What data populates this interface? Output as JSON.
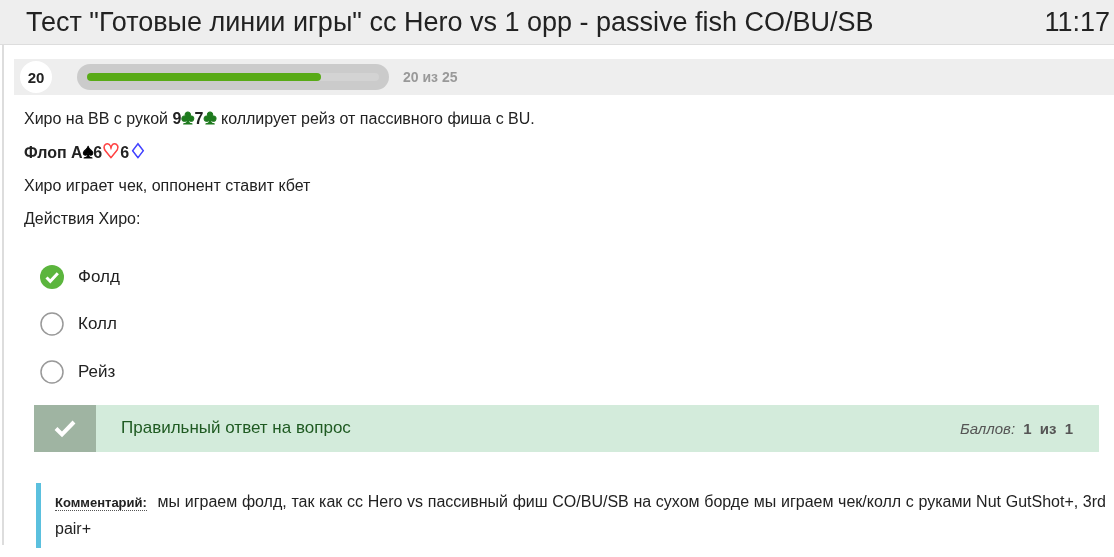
{
  "header": {
    "title": "Тест \"Готовые линии игры\" cc Hero vs 1 opp - passive fish CO/BU/SB",
    "time": "11:17"
  },
  "progress": {
    "number": "20",
    "level": 0.8,
    "label": "20 из 25"
  },
  "question": [
    {
      "segments": [
        {
          "kind": "text",
          "text": "Хиро на BB с рукой "
        },
        {
          "kind": "bold",
          "text": "9"
        },
        {
          "kind": "suit",
          "text": "♣",
          "color": "#1e7a1e"
        },
        {
          "kind": "bold",
          "text": "7"
        },
        {
          "kind": "suit",
          "text": "♣",
          "color": "#1e7a1e"
        },
        {
          "kind": "text",
          "text": " коллирует рейз от пассивного фиша с BU."
        }
      ]
    },
    {
      "segments": [
        {
          "kind": "bold",
          "text": "Флоп А"
        },
        {
          "kind": "suit",
          "text": "♠",
          "color": "#000000"
        },
        {
          "kind": "bold",
          "text": "6"
        },
        {
          "kind": "suit",
          "text": "♡",
          "color": "#ff4444"
        },
        {
          "kind": "bold",
          "text": "6"
        },
        {
          "kind": "suit",
          "text": "♢",
          "color": "#4444ff"
        }
      ]
    },
    {
      "segments": [
        {
          "kind": "text",
          "text": "Хиро играет чек, оппонент ставит кбет"
        }
      ]
    },
    {
      "segments": [
        {
          "kind": "text",
          "text": "Действия Хиро:"
        }
      ]
    }
  ],
  "options": [
    {
      "label": "Фолд",
      "selected": true
    },
    {
      "label": "Колл",
      "selected": false
    },
    {
      "label": "Рейз",
      "selected": false
    }
  ],
  "feedback": {
    "text": "Правильный ответ на вопрос",
    "score_label": "Баллов:",
    "score": "1",
    "of": "из",
    "max": "1"
  },
  "comment": {
    "label": "Комментарий:",
    "text": "мы играем фолд, так как cc Hero vs пассивный фиш CO/BU/SB на сухом борде мы играем чек/колл с руками Nut GutShot+, 3rd pair+"
  }
}
